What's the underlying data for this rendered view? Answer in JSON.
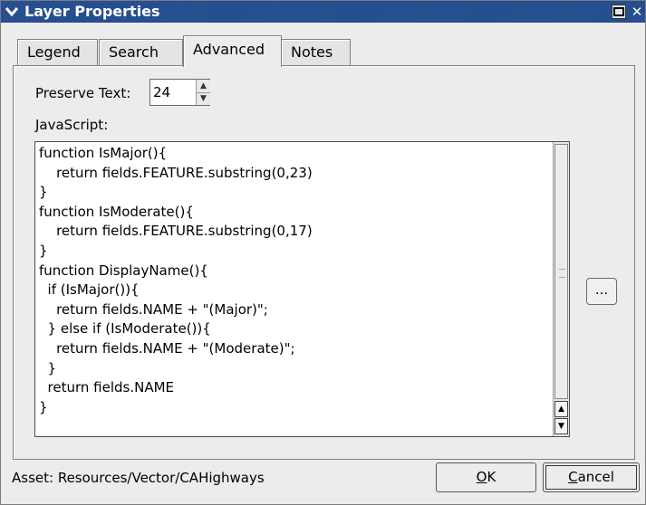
{
  "window": {
    "title": "Layer Properties"
  },
  "tabs": [
    {
      "label": "Legend",
      "active": false
    },
    {
      "label": "Search",
      "active": false
    },
    {
      "label": "Advanced",
      "active": true
    },
    {
      "label": "Notes",
      "active": false
    }
  ],
  "advanced": {
    "preserve_text_label": "Preserve Text:",
    "preserve_text_value": "24",
    "javascript_label": "JavaScript:",
    "javascript_code": "function IsMajor(){\n    return fields.FEATURE.substring(0,23)\n}\nfunction IsModerate(){\n    return fields.FEATURE.substring(0,17)\n}\nfunction DisplayName(){\n  if (IsMajor()){\n    return fields.NAME + \"(Major)\";\n  } else if (IsModerate()){\n    return fields.NAME + \"(Moderate)\";\n  }\n  return fields.NAME\n}",
    "browse_button_label": "..."
  },
  "footer": {
    "asset_label": "Asset:  Resources/Vector/CAHighways",
    "ok_mnemonic": "O",
    "ok_rest": "K",
    "cancel_mnemonic": "C",
    "cancel_rest": "ancel"
  },
  "icons": {
    "window_menu": "chevron-down-icon",
    "maximize": "maximize-icon",
    "close": "close-icon"
  },
  "colors": {
    "titlebar": "#214a8d",
    "dialog_bg": "#ececec"
  }
}
